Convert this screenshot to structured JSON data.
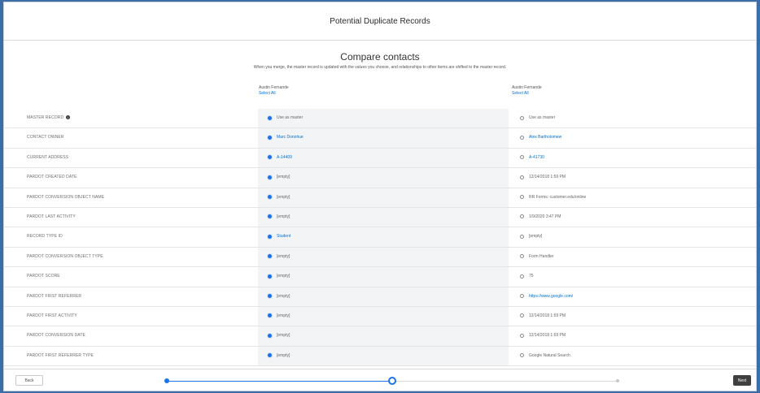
{
  "modal": {
    "title": "Potential Duplicate Records"
  },
  "intro": {
    "title": "Compare contacts",
    "description": "When you merge, the master record is updated with the values you choose, and relationships to other items are shifted to the master record."
  },
  "columns": [
    {
      "name": "Austin Fernande",
      "select_all": "Select All"
    },
    {
      "name": "Austin Fernande",
      "select_all": "Select All"
    }
  ],
  "rows": [
    {
      "label": "Master Record",
      "info": true,
      "v1": "Use as master",
      "v1_link": false,
      "v2": "Use as master",
      "v2_link": false,
      "selected": 1
    },
    {
      "label": "Contact Owner",
      "v1": "Marc Donohue",
      "v1_link": true,
      "v2": "Alex Bartholomew",
      "v2_link": true,
      "selected": 1
    },
    {
      "label": "Current Address",
      "v1": "A-14409",
      "v1_link": true,
      "v2": "A-41730",
      "v2_link": true,
      "selected": 1
    },
    {
      "label": "Pardot Created Date",
      "v1": "[empty]",
      "v1_link": false,
      "v2": "12/14/2018 1:59 PM",
      "v2_link": false,
      "selected": 1
    },
    {
      "label": "Pardot Conversion Object Name",
      "v1": "[empty]",
      "v1_link": false,
      "v2": "RR Forms: customer.edu/online",
      "v2_link": false,
      "selected": 1
    },
    {
      "label": "Pardot Last Activity",
      "v1": "[empty]",
      "v1_link": false,
      "v2": "1/9/2020 3:47 PM",
      "v2_link": false,
      "selected": 1
    },
    {
      "label": "Record Type ID",
      "v1": "Student",
      "v1_link": true,
      "v2": "[empty]",
      "v2_link": false,
      "selected": 1
    },
    {
      "label": "Pardot Conversion Object Type",
      "v1": "[empty]",
      "v1_link": false,
      "v2": "Form Handler",
      "v2_link": false,
      "selected": 1
    },
    {
      "label": "Pardot Score",
      "v1": "[empty]",
      "v1_link": false,
      "v2": "75",
      "v2_link": false,
      "selected": 1
    },
    {
      "label": "Pardot First Referrer",
      "v1": "[empty]",
      "v1_link": false,
      "v2": "https://www.google.com/",
      "v2_link": true,
      "selected": 1
    },
    {
      "label": "Pardot First Activity",
      "v1": "[empty]",
      "v1_link": false,
      "v2": "12/14/2018 1:59 PM",
      "v2_link": false,
      "selected": 1
    },
    {
      "label": "Pardot Conversion Date",
      "v1": "[empty]",
      "v1_link": false,
      "v2": "12/14/2018 1:59 PM",
      "v2_link": false,
      "selected": 1
    },
    {
      "label": "Pardot First Referrer Type",
      "v1": "[empty]",
      "v1_link": false,
      "v2": "Google Natural Search",
      "v2_link": false,
      "selected": 1
    }
  ],
  "footer": {
    "back_label": "Back",
    "next_label": "Next",
    "steps": [
      {
        "state": "complete"
      },
      {
        "state": "current"
      },
      {
        "state": "upcoming"
      }
    ]
  },
  "colors": {
    "accent": "#1b73e8",
    "link": "#0070d2",
    "frame": "#3b6ea5",
    "next_button": "#3f3f3f"
  }
}
